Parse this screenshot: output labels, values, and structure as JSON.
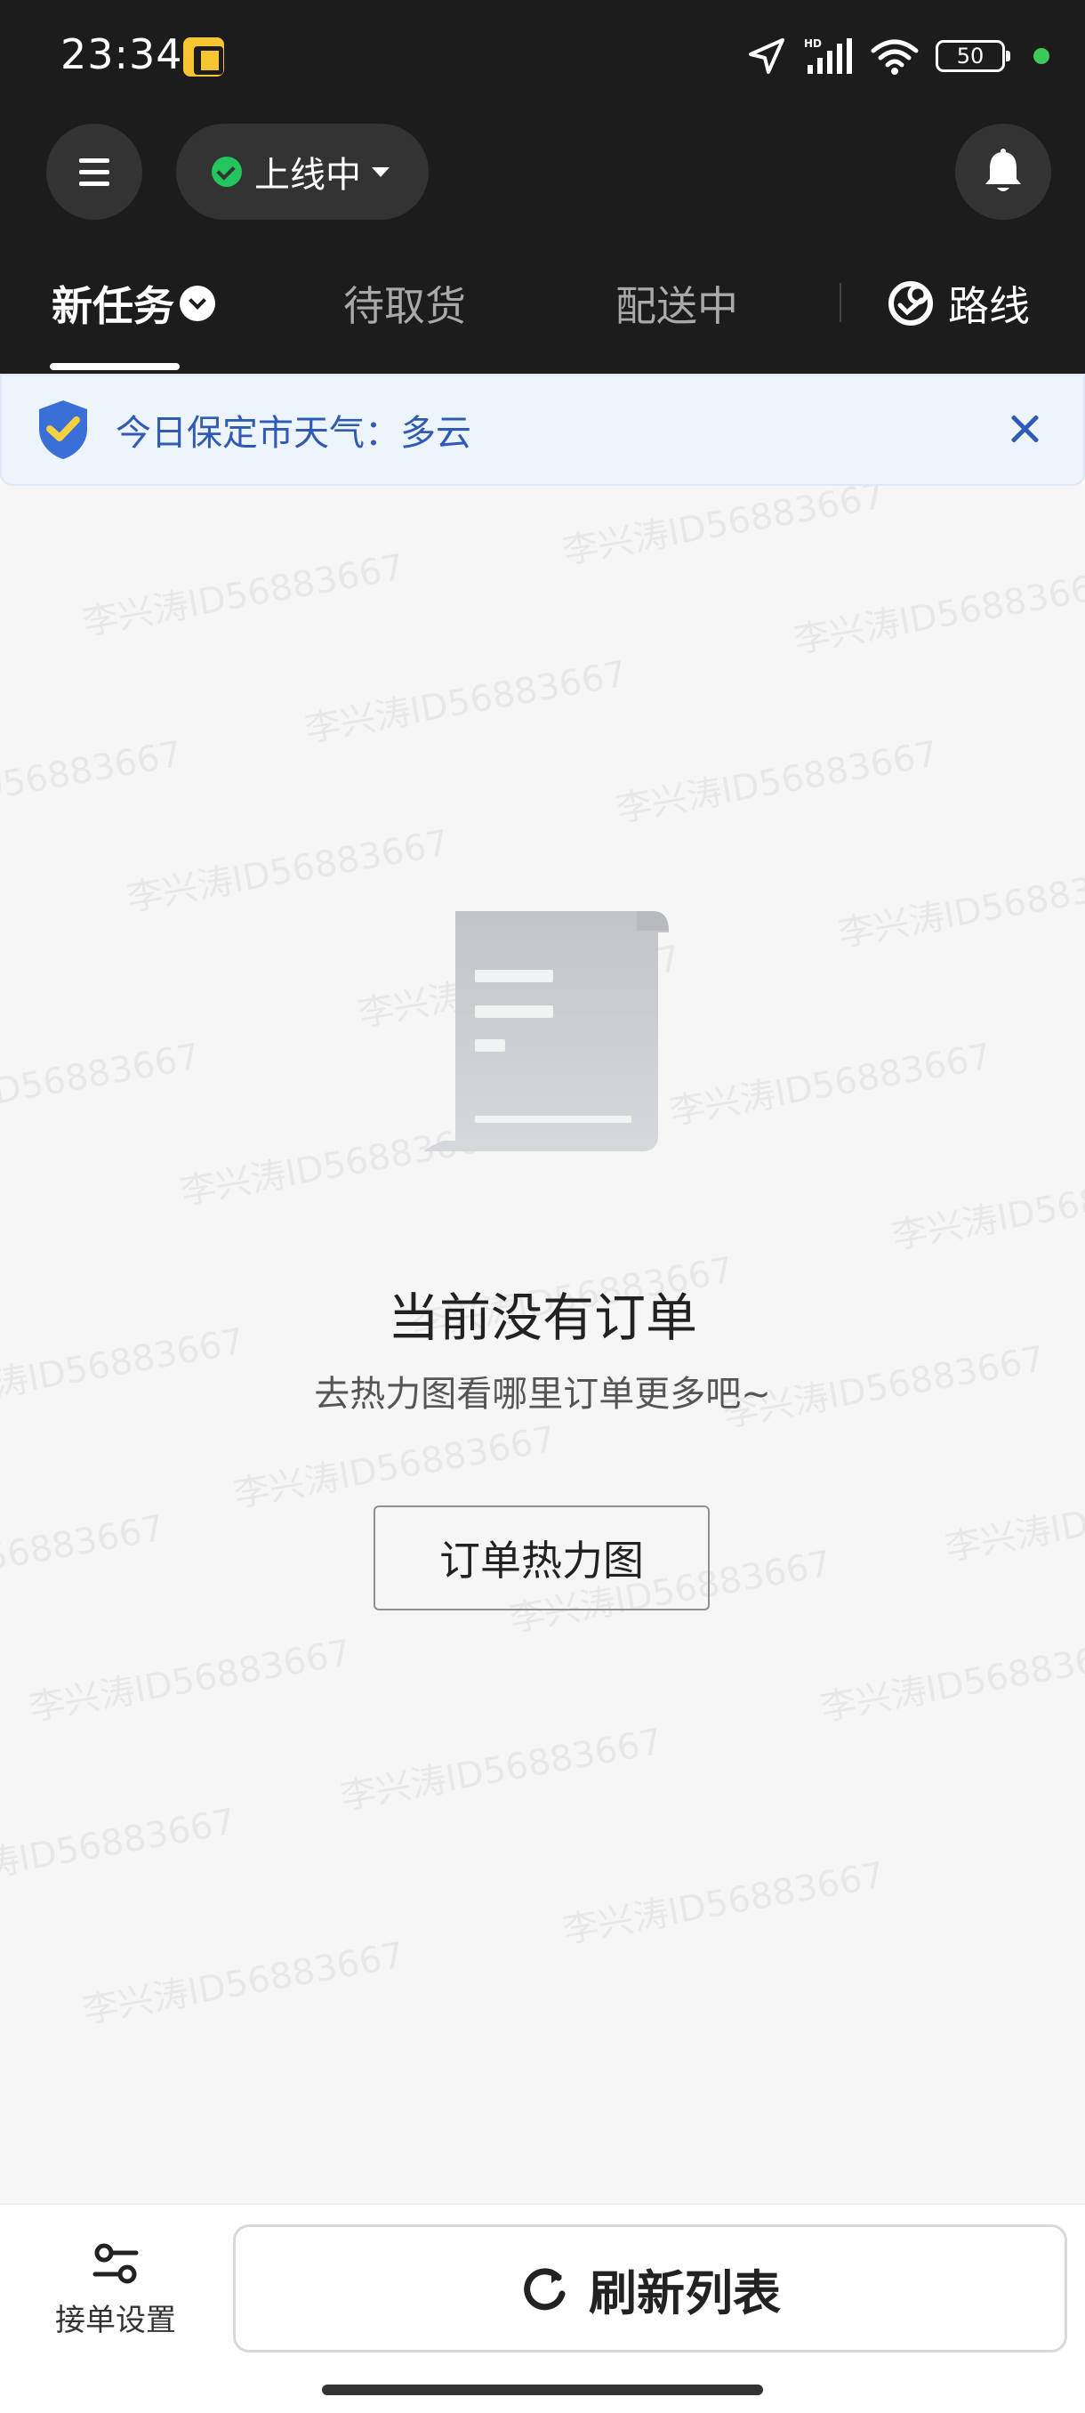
{
  "status_bar": {
    "time": "23:34",
    "battery": "50",
    "icons": [
      "app-icon",
      "location-arrow-icon",
      "signal-hd-icon",
      "wifi-icon",
      "battery-icon"
    ]
  },
  "header": {
    "status_pill": "上线中",
    "tabs": [
      {
        "label": "新任务",
        "active": true
      },
      {
        "label": "待取货",
        "active": false
      },
      {
        "label": "配送中",
        "active": false
      },
      {
        "label": "路线",
        "active": false
      }
    ]
  },
  "banner": {
    "text": "今日保定市天气：多云"
  },
  "watermark": "李兴涛ID56883667",
  "empty_state": {
    "title": "当前没有订单",
    "subtitle": "去热力图看哪里订单更多吧~",
    "button": "订单热力图"
  },
  "bottom_bar": {
    "settings_label": "接单设置",
    "refresh_label": "刷新列表"
  },
  "colors": {
    "header_bg": "#1c1c1c",
    "online_green": "#22c55e",
    "banner_text": "#2f5bb5",
    "shield_blue": "#3b6fd8",
    "shield_yellow": "#f5d142"
  }
}
